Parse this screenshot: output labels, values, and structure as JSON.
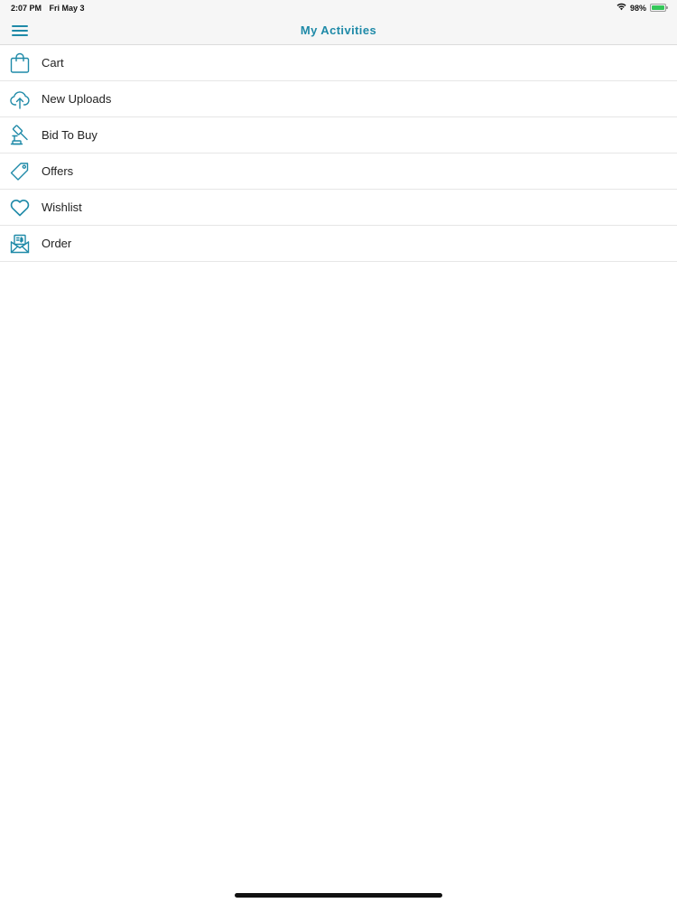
{
  "status_bar": {
    "time": "2:07 PM",
    "date": "Fri May 3",
    "battery_percent": "98%",
    "wifi_icon": "wifi-icon",
    "battery_level": 0.98,
    "battery_color": "#34c759"
  },
  "nav": {
    "title": "My Activities",
    "menu_icon": "hamburger-menu-icon",
    "accent_color": "#1f8aa8"
  },
  "menu": {
    "items": [
      {
        "label": "Cart",
        "icon": "shopping-bag-icon"
      },
      {
        "label": "New Uploads",
        "icon": "cloud-upload-icon"
      },
      {
        "label": "Bid To Buy",
        "icon": "auction-gavel-icon"
      },
      {
        "label": "Offers",
        "icon": "price-tag-icon"
      },
      {
        "label": "Wishlist",
        "icon": "heart-icon"
      },
      {
        "label": "Order",
        "icon": "order-envelope-icon"
      }
    ]
  }
}
